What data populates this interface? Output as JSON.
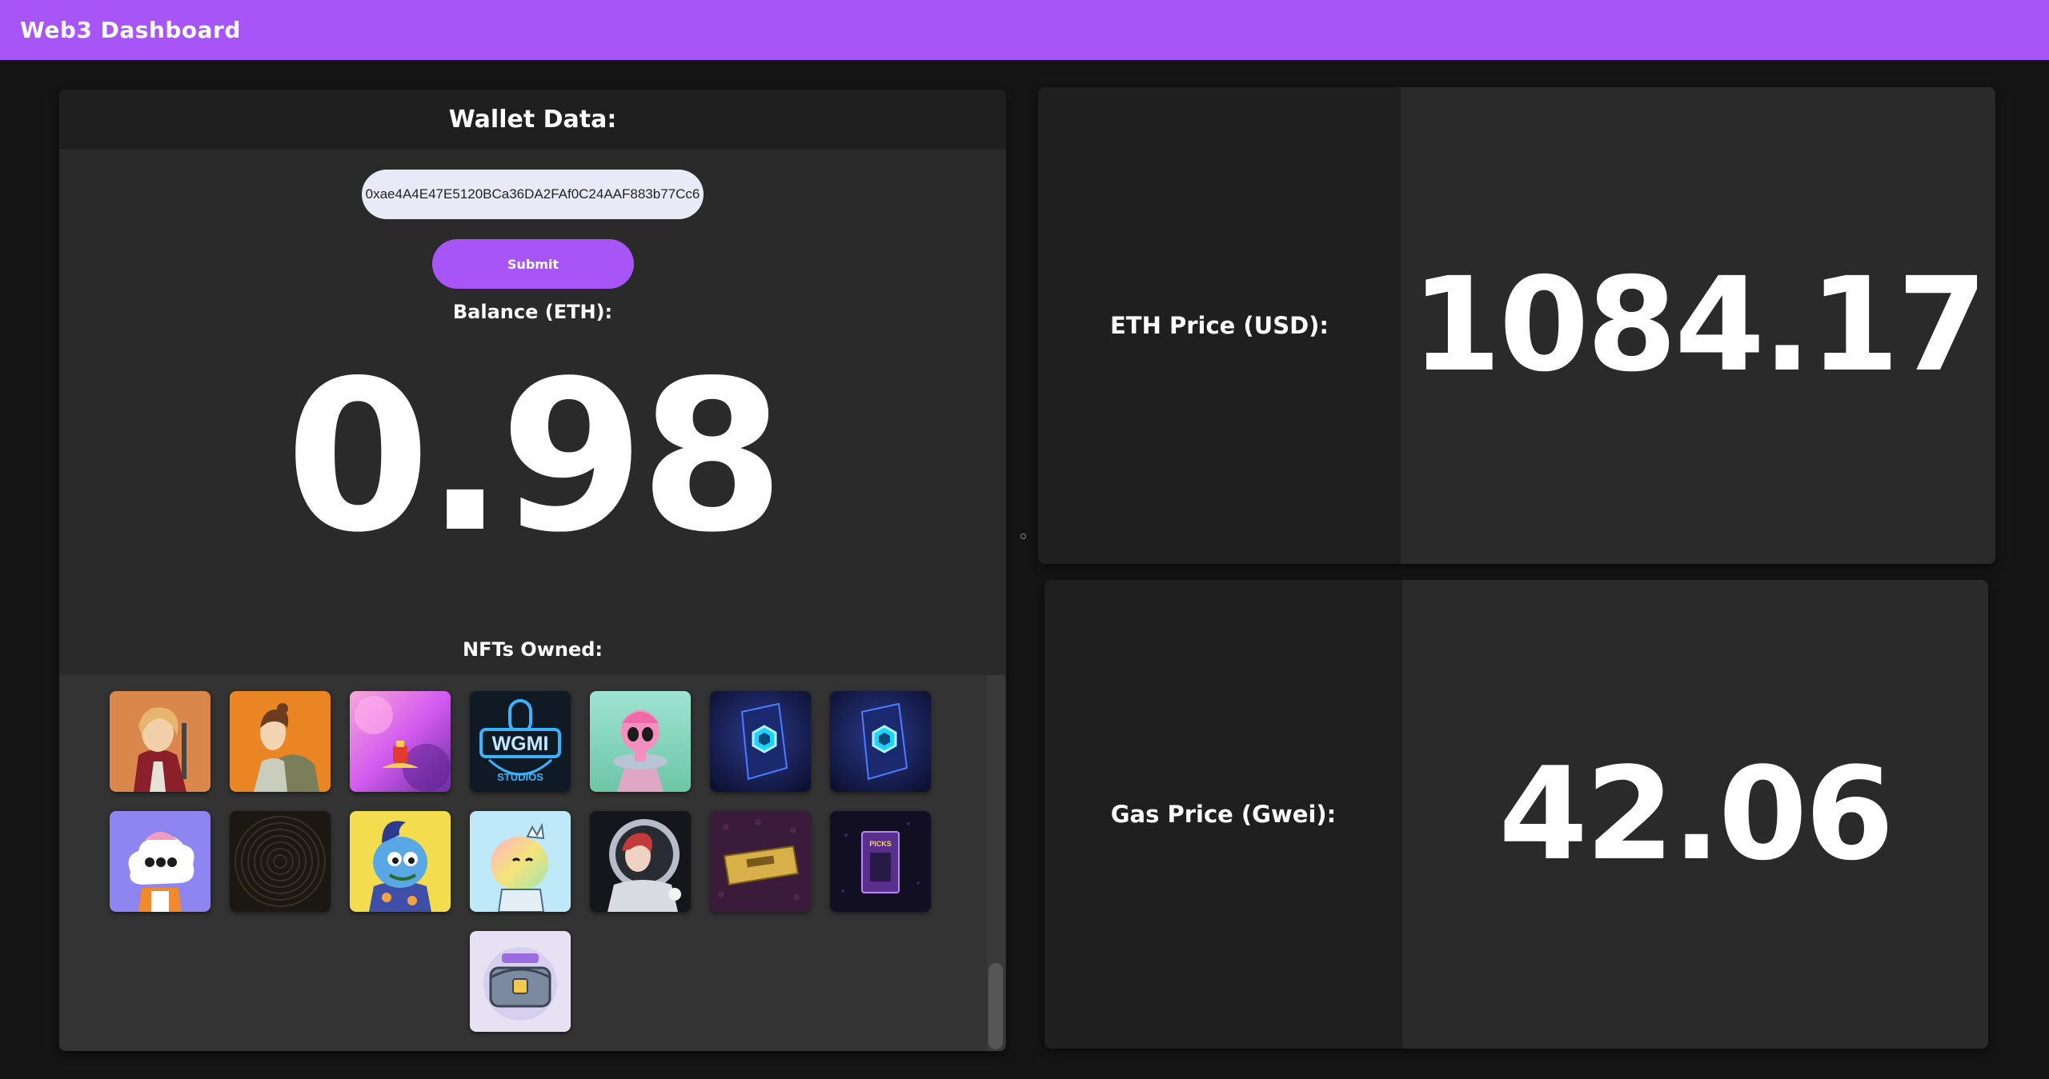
{
  "header": {
    "title": "Web3 Dashboard",
    "bg": "#a855f7"
  },
  "wallet": {
    "title": "Wallet Data:",
    "address_value": "0xae4A4E47E5120BCa36DA2FAf0C24AAF883b77Cc6",
    "submit_label": "Submit",
    "balance_label": "Balance (ETH):",
    "balance_value": "0.98",
    "nfts_label": "NFTs Owned:",
    "nfts": [
      {
        "icon": "nft-red-jacket-character"
      },
      {
        "icon": "nft-backpack-character"
      },
      {
        "icon": "nft-pink-purple-abstract"
      },
      {
        "icon": "nft-wgmi-studios-logo"
      },
      {
        "icon": "nft-pink-alien-ufo"
      },
      {
        "icon": "nft-blue-crystal-box"
      },
      {
        "icon": "nft-blue-crystal-box"
      },
      {
        "icon": "nft-cloud-character"
      },
      {
        "icon": "nft-dark-spiral"
      },
      {
        "icon": "nft-blue-monster"
      },
      {
        "icon": "nft-rainbow-blob"
      },
      {
        "icon": "nft-astronaut-portrait"
      },
      {
        "icon": "nft-gold-ticket"
      },
      {
        "icon": "nft-purple-card"
      },
      {
        "icon": "nft-treasure-chest"
      }
    ]
  },
  "eth": {
    "label": "ETH Price (USD):",
    "value": "1084.17"
  },
  "gas": {
    "label": "Gas Price (Gwei):",
    "value": "42.06"
  }
}
